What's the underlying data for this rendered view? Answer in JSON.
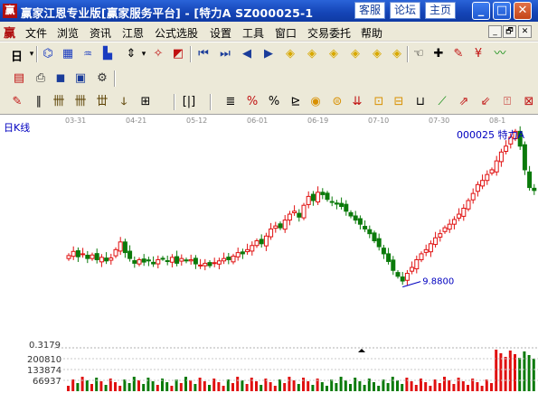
{
  "window": {
    "title": "赢家江恩专业版[赢家服务平台] - [特力A   SZ000025-1",
    "icon": "app-logo-icon",
    "top_buttons": [
      "客服",
      "论坛",
      "主页"
    ],
    "controls": {
      "minimize": "_",
      "maximize": "□",
      "close": "✕"
    }
  },
  "menu": {
    "logo": "赢",
    "items": [
      "文件",
      "浏览",
      "资讯",
      "江恩",
      "公式选股",
      "设置",
      "工具",
      "窗口",
      "交易委托",
      "帮助"
    ],
    "mdi_controls": [
      "_",
      "🗗",
      "✕"
    ]
  },
  "toolbar": {
    "period": "日",
    "period_arrow": "▾",
    "row1_icons": [
      "chart-icon",
      "grid-icon",
      "sort-icon",
      "bar-icon",
      "arrow-icon",
      "diamond-icon",
      "flag-icon",
      "first-icon",
      "last-icon",
      "left-icon",
      "right-icon",
      "ind1-icon",
      "ind2-icon",
      "ind3-icon",
      "ind4-icon",
      "ind5-icon",
      "ind6-icon",
      "hand-icon",
      "cross-icon",
      "draw-icon",
      "money-icon",
      "line-icon"
    ],
    "row2_icons": [
      "calendar-icon",
      "print-icon",
      "save-icon",
      "disk-icon",
      "gear-icon"
    ]
  },
  "chart": {
    "stock_label": "000025 特力A",
    "period_label": "日K线",
    "min_price_label": "9.8800",
    "colors": {
      "up": "#e01010",
      "down": "#0a7a0a",
      "axis": "#b0b0b0",
      "annotation": "#0000c0"
    }
  },
  "chart_data": [
    {
      "type": "candlestick",
      "title": "日K线",
      "x_labels": [
        "03-31",
        "04-21",
        "05-12",
        "06-01",
        "06-19",
        "07-10",
        "07-30",
        "08-1"
      ],
      "annotations": [
        {
          "label": "9.8800",
          "kind": "period-low"
        }
      ],
      "closes": [
        10.35,
        10.42,
        10.33,
        10.38,
        10.3,
        10.36,
        10.28,
        10.32,
        10.26,
        10.31,
        10.45,
        10.58,
        10.4,
        10.3,
        10.22,
        10.28,
        10.24,
        10.26,
        10.21,
        10.28,
        10.3,
        10.25,
        10.32,
        10.22,
        10.3,
        10.26,
        10.28,
        10.21,
        10.19,
        10.22,
        10.18,
        10.23,
        10.26,
        10.3,
        10.28,
        10.34,
        10.4,
        10.38,
        10.45,
        10.52,
        10.6,
        10.55,
        10.68,
        10.8,
        10.85,
        10.82,
        10.95,
        11.05,
        11.1,
        11.0,
        11.2,
        11.35,
        11.28,
        11.42,
        11.38,
        11.3,
        11.25,
        11.22,
        11.18,
        11.1,
        11.02,
        10.95,
        10.88,
        10.8,
        10.72,
        10.6,
        10.5,
        10.38,
        10.25,
        10.1,
        10.0,
        9.92,
        10.05,
        10.15,
        10.28,
        10.38,
        10.45,
        10.55,
        10.65,
        10.72,
        10.82,
        10.88,
        10.96,
        11.05,
        11.15,
        11.28,
        11.4,
        11.55,
        11.62,
        11.72,
        11.8,
        11.95,
        12.1,
        12.2,
        12.35,
        12.45,
        12.2,
        11.8,
        11.5,
        11.45,
        11.3
      ],
      "volume_axis_labels": [
        "200810",
        "133874",
        "66937"
      ],
      "indicator_label": "0.3179"
    }
  ]
}
